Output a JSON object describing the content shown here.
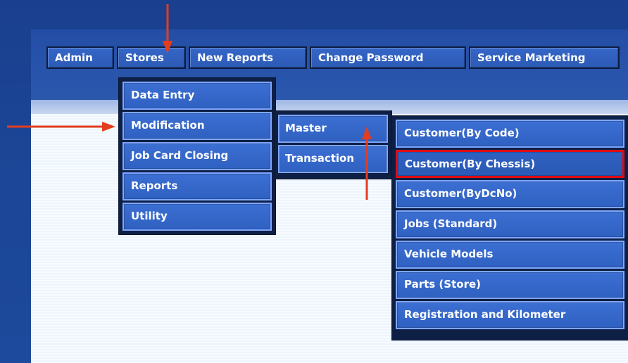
{
  "menubar": {
    "items": [
      {
        "label": "Admin"
      },
      {
        "label": "Stores"
      },
      {
        "label": "New Reports"
      },
      {
        "label": "Change Password"
      },
      {
        "label": "Service Marketing"
      }
    ]
  },
  "stores_menu": {
    "items": [
      {
        "label": "Data Entry"
      },
      {
        "label": "Modification"
      },
      {
        "label": "Job Card Closing"
      },
      {
        "label": "Reports"
      },
      {
        "label": "Utility"
      }
    ]
  },
  "modification_menu": {
    "items": [
      {
        "label": "Master"
      },
      {
        "label": "Transaction"
      }
    ]
  },
  "master_menu": {
    "items": [
      {
        "label": "Customer(By Code)"
      },
      {
        "label": "Customer(By Chessis)"
      },
      {
        "label": "Customer(ByDcNo)"
      },
      {
        "label": "Jobs (Standard)"
      },
      {
        "label": "Vehicle Models"
      },
      {
        "label": "Parts (Store)"
      },
      {
        "label": "Registration and Kilometer"
      }
    ]
  },
  "annotations": {
    "arrow_color": "#e33d1f",
    "highlight_color": "#df0b12"
  }
}
